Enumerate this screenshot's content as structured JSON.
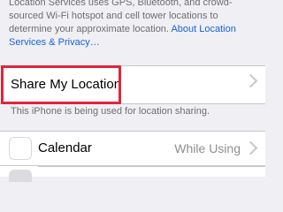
{
  "header_text": {
    "line1": "Location Services uses GPS, Bluetooth, and crowd-",
    "line2": "sourced Wi-Fi hotspot and cell tower locations to",
    "line3_prefix": "determine your approximate location. ",
    "line3_link": "About Location",
    "line4_link": "Services & Privacy…"
  },
  "share_row": {
    "label": "Share My Location"
  },
  "share_note": "This iPhone is being used for location sharing.",
  "apps": [
    {
      "label": "Calendar",
      "value": "While Using",
      "icon": "calendar-icon"
    }
  ],
  "colors": {
    "highlight": "#e0253a",
    "link": "#1a62d6",
    "background": "#efeff4"
  }
}
